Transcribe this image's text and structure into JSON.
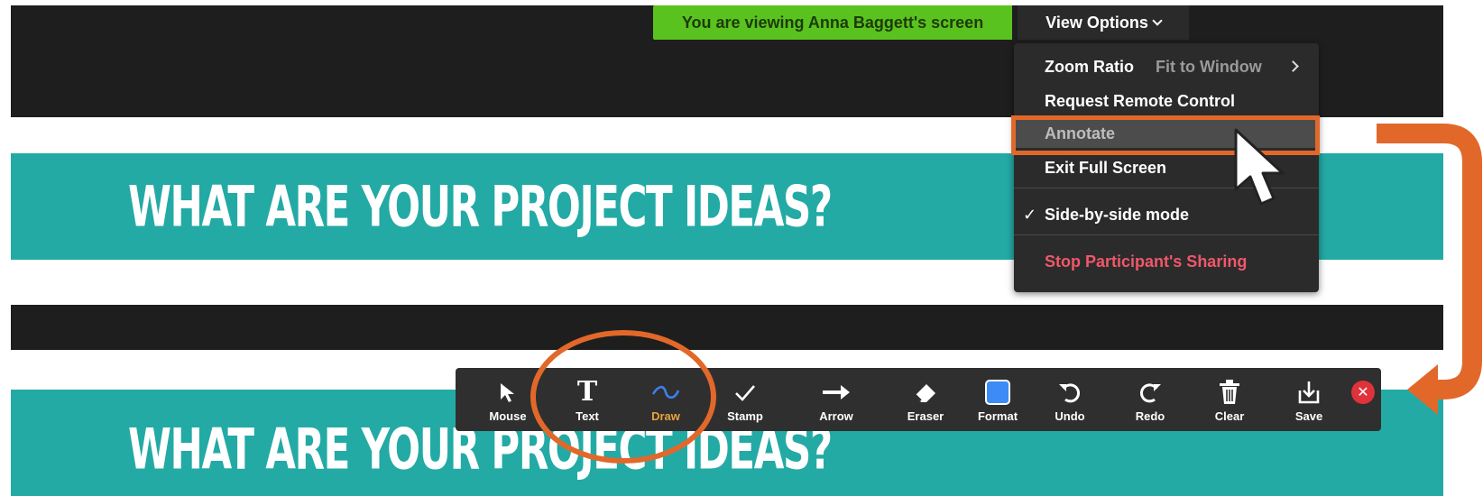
{
  "viewing_banner": {
    "text": "You are viewing Anna Baggett's screen"
  },
  "view_options": {
    "label": "View Options"
  },
  "menu": {
    "zoom_ratio": {
      "label": "Zoom Ratio",
      "value": "Fit to Window"
    },
    "request_remote_control": "Request Remote Control",
    "annotate": "Annotate",
    "exit_full_screen": "Exit Full Screen",
    "side_by_side": {
      "label": "Side-by-side mode",
      "checked": true
    },
    "stop_sharing": "Stop Participant's Sharing"
  },
  "slides": {
    "top_title": "WHAT ARE YOUR PROJECT IDEAS?",
    "bottom_title": "WHAT ARE YOUR PROJECT IDEAS?"
  },
  "toolbar": {
    "tools": [
      {
        "label": "Mouse",
        "icon": "cursor-icon"
      },
      {
        "label": "Text",
        "icon": "text-icon"
      },
      {
        "label": "Draw",
        "icon": "draw-icon",
        "active": true
      },
      {
        "label": "Stamp",
        "icon": "checkmark-icon"
      },
      {
        "label": "Arrow",
        "icon": "arrow-icon"
      },
      {
        "label": "Eraser",
        "icon": "eraser-icon"
      },
      {
        "label": "Format",
        "icon": "format-icon"
      },
      {
        "label": "Undo",
        "icon": "undo-icon"
      },
      {
        "label": "Redo",
        "icon": "redo-icon"
      },
      {
        "label": "Clear",
        "icon": "trash-icon"
      },
      {
        "label": "Save",
        "icon": "save-icon"
      }
    ],
    "close_icon": "close-icon"
  },
  "colors": {
    "accent_orange": "#e2682a",
    "teal_banner": "#23aaa5",
    "viewing_green": "#5ac21f",
    "danger_text": "#f0576a",
    "draw_active": "#e8a33a",
    "format_blue": "#3d8bf5"
  }
}
